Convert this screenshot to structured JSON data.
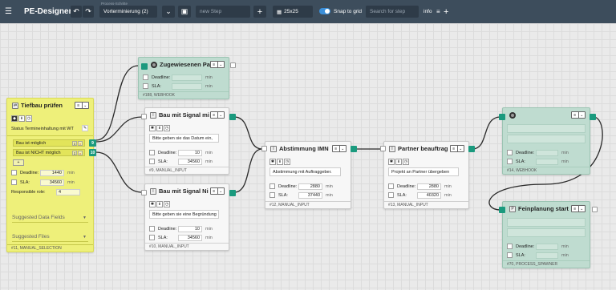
{
  "toolbar": {
    "menu_icon": "hamburger-collapse-icon",
    "app_title": "PE-Designer",
    "undo_icon": "undo-icon",
    "redo_icon": "redo-icon",
    "process_label": "Process-Schritte",
    "process_select": "Vorterminierung (2)",
    "chevron": "⌄",
    "new_step_placeholder": "new Step",
    "add": "+",
    "grid_size": "25x25",
    "snap_label": "Snap to grid",
    "search_placeholder": "Search for step",
    "info": "info",
    "colors": {
      "toolbar_bg": "#3d4d5c",
      "accent": "#1a9a7e",
      "toggle": "#3b8fd9"
    }
  },
  "nodes": {
    "tiefbau": {
      "title": "Tiefbau prüfen",
      "status_text": "Status Termineinhaltung mit WT",
      "options": [
        {
          "label": "Bau ist möglich",
          "port": "9"
        },
        {
          "label": "Bau ist NICHT möglich",
          "port": "10"
        }
      ],
      "add_option": "+",
      "deadline_label": "Deadline:",
      "deadline_value": "1440",
      "sla_label": "SLA:",
      "sla_value": "34560",
      "unit": "min",
      "role_label": "Responsible role:",
      "role_value": "4",
      "suggested_fields": "Suggested Data Fields",
      "suggested_files": "Suggested Files",
      "footer": "#11, MANUAL_SELECTION"
    },
    "zugewiesen": {
      "title": "Zugewiesenen Pa",
      "deadline_label": "Deadline:",
      "sla_label": "SLA:",
      "unit": "min",
      "footer": "#188, WEBHOOK"
    },
    "signal1": {
      "title": "Bau mit Signal mi",
      "desc": "Bitte geben sie das Datum ein,",
      "deadline_label": "Deadline:",
      "deadline_value": "10",
      "sla_label": "SLA:",
      "sla_value": "34560",
      "unit": "min",
      "footer": "#9, MANUAL_INPUT"
    },
    "signal2": {
      "title": "Bau mit Signal Ni",
      "desc": "Bitte geben sie eine Begründung",
      "deadline_label": "Deadline:",
      "deadline_value": "10",
      "sla_label": "SLA:",
      "sla_value": "34560",
      "unit": "min",
      "footer": "#10, MANUAL_INPUT"
    },
    "abstimmung": {
      "title": "Abstimmung IMN",
      "desc": "Abstimmung mit Auftraggeber.",
      "deadline_label": "Deadline:",
      "deadline_value": "2880",
      "sla_label": "SLA:",
      "sla_value": "37440",
      "unit": "min",
      "footer": "#12, MANUAL_INPUT"
    },
    "partner": {
      "title": "Partner beauftrag",
      "desc": "Projekt an Partner übergeben",
      "deadline_label": "Deadline:",
      "deadline_value": "2880",
      "sla_label": "SLA:",
      "sla_value": "40320",
      "unit": "min",
      "footer": "#13, MANUAL_INPUT"
    },
    "webhook14": {
      "deadline_label": "Deadline:",
      "sla_label": "SLA:",
      "unit": "min",
      "footer": "#14, WEBHOOK"
    },
    "feinplanung": {
      "title": "Feinplanung start",
      "deadline_label": "Deadline:",
      "sla_label": "SLA:",
      "unit": "min",
      "footer": "#70, PROCESS_SPAWNER"
    }
  },
  "menu_glyphs": {
    "list": "≡",
    "chevron": "⌄"
  },
  "icon_glyphs": {
    "diamond": "◆",
    "pin": "⇟",
    "clock": "◷",
    "gear": "✱"
  }
}
